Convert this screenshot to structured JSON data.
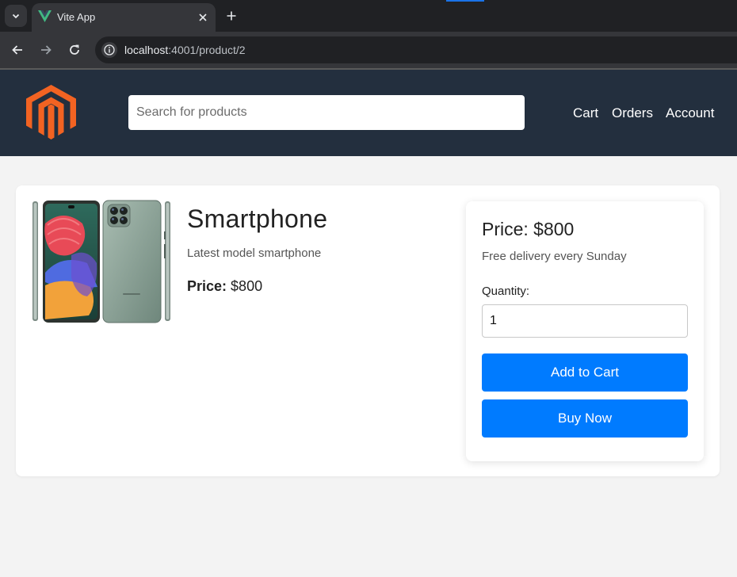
{
  "browser": {
    "tab_title": "Vite App",
    "url_host": "localhost",
    "url_path": ":4001/product/2"
  },
  "header": {
    "logo_icon": "magento-logo",
    "search_placeholder": "Search for products",
    "nav": [
      "Cart",
      "Orders",
      "Account"
    ]
  },
  "product": {
    "name": "Smartphone",
    "description": "Latest model smartphone",
    "price_label": "Price:",
    "price_value": "$800",
    "image_icon": "smartphone-image"
  },
  "purchase": {
    "price_text": "Price: $800",
    "delivery_text": "Free delivery every Sunday",
    "quantity_label": "Quantity:",
    "quantity_value": "1",
    "add_to_cart_label": "Add to Cart",
    "buy_now_label": "Buy Now"
  },
  "colors": {
    "header_bg": "#232f3e",
    "button_blue": "#007bff",
    "logo_orange": "#f26322"
  }
}
